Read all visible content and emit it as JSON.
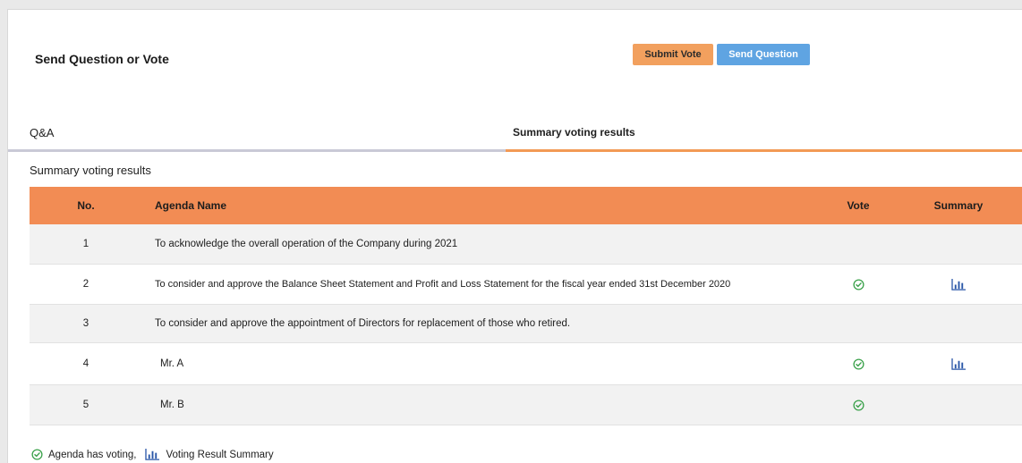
{
  "header": {
    "title": "Send Question or Vote",
    "submit_vote_label": "Submit Vote",
    "send_question_label": "Send Question"
  },
  "tabs": [
    {
      "label": "Q&A",
      "active": false
    },
    {
      "label": "Summary voting results",
      "active": true
    }
  ],
  "section_title": "Summary voting results",
  "table": {
    "columns": [
      "No.",
      "Agenda Name",
      "Vote",
      "Summary"
    ],
    "rows": [
      {
        "no": "1",
        "agenda": "To acknowledge the overall operation of the Company during 2021",
        "vote": false,
        "summary": false
      },
      {
        "no": "2",
        "agenda": "To consider and approve the Balance Sheet Statement and Profit and Loss Statement for the fiscal year ended 31st December 2020",
        "vote": true,
        "summary": true
      },
      {
        "no": "3",
        "agenda": "To consider and approve the appointment of Directors for replacement of those who retired.",
        "vote": false,
        "summary": false
      },
      {
        "no": "4",
        "agenda": "Mr. A",
        "vote": true,
        "summary": true
      },
      {
        "no": "5",
        "agenda": "Mr. B",
        "vote": true,
        "summary": false
      }
    ]
  },
  "legend": {
    "vote_label": "Agenda has voting,",
    "summary_label": "Voting Result Summary"
  },
  "icons": {
    "vote": "check-circle-icon",
    "summary": "bar-chart-icon"
  },
  "colors": {
    "accent_orange": "#f28c54",
    "button_orange": "#f2a05e",
    "button_blue": "#5fa4e2",
    "check_green": "#3aa14a",
    "chart_blue": "#2a57a8"
  }
}
